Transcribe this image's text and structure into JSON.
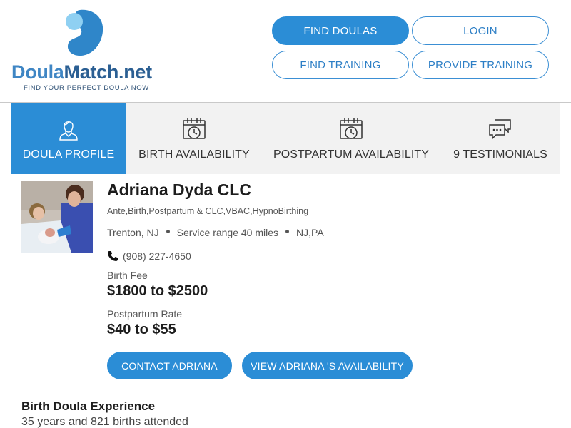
{
  "brand": {
    "name_part1": "Doula",
    "name_part2": "Match.net",
    "tagline": "FIND YOUR PERFECT DOULA NOW",
    "colors": {
      "primary": "#2b8dd6",
      "light": "#8fd0f2",
      "dark": "#2b5f93"
    }
  },
  "nav": {
    "find_doulas": "FIND DOULAS",
    "login": "LOGIN",
    "find_training": "FIND TRAINING",
    "provide_training": "PROVIDE TRAINING"
  },
  "tabs": [
    {
      "label": "DOULA PROFILE",
      "icon": "person-icon",
      "active": true
    },
    {
      "label": "BIRTH AVAILABILITY",
      "icon": "calendar-clock-icon",
      "active": false
    },
    {
      "label": "POSTPARTUM AVAILABILITY",
      "icon": "calendar-clock-icon",
      "active": false
    },
    {
      "label": "9 TESTIMONIALS",
      "icon": "chat-bubbles-icon",
      "active": false
    }
  ],
  "profile": {
    "name": "Adriana Dyda CLC",
    "specialties": "Ante,Birth,Postpartum & CLC,VBAC,HypnoBirthing",
    "city": "Trenton, NJ",
    "service_range": "Service range 40 miles",
    "states": "NJ,PA",
    "phone": "(908) 227-4650",
    "birth_fee_label": "Birth Fee",
    "birth_fee": "$1800 to $2500",
    "postpartum_label": "Postpartum Rate",
    "postpartum_rate": "$40 to $55",
    "contact_button": "CONTACT ADRIANA",
    "availability_button": "VIEW ADRIANA 'S AVAILABILITY"
  },
  "experience": {
    "title": "Birth Doula Experience",
    "text": "35 years and 821 births attended"
  }
}
